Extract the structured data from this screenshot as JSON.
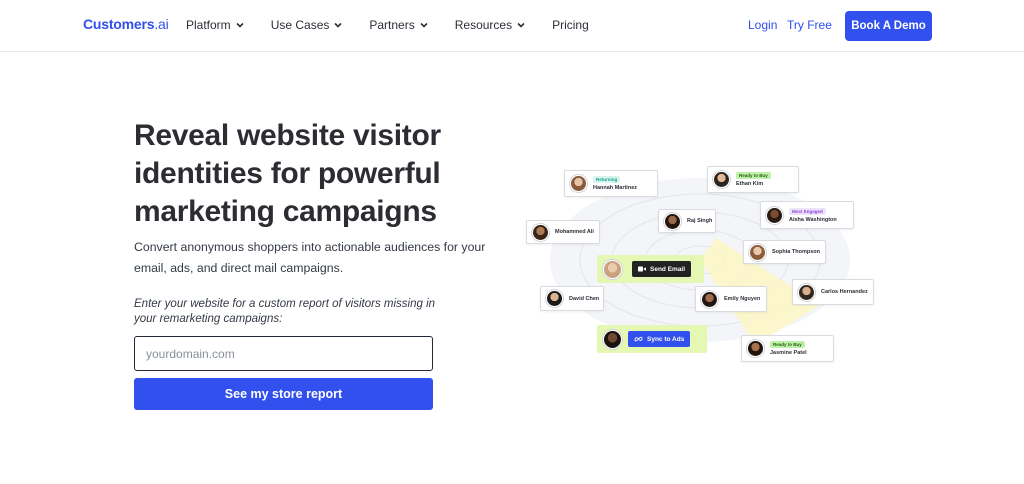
{
  "nav": {
    "logo_main": "Customers",
    "logo_suffix": ".ai",
    "menu": [
      {
        "label": "Platform",
        "has_dropdown": true
      },
      {
        "label": "Use Cases",
        "has_dropdown": true
      },
      {
        "label": "Partners",
        "has_dropdown": true
      },
      {
        "label": "Resources",
        "has_dropdown": true
      },
      {
        "label": "Pricing",
        "has_dropdown": false
      }
    ],
    "login": "Login",
    "try_free": "Try Free",
    "book_demo": "Book A Demo"
  },
  "hero": {
    "title": "Reveal website visitor identities for powerful marketing campaigns",
    "subtitle": "Convert anonymous shoppers into actionable audiences for your email, ads, and direct mail campaigns.",
    "prompt": "Enter your website for a custom report of visitors missing in your remarketing campaigns:",
    "input_placeholder": "yourdomain.com",
    "cta": "See my store report"
  },
  "graphic": {
    "cards": [
      {
        "name": "Hannah Martinez",
        "tag": "Returning",
        "tag_color": "teal"
      },
      {
        "name": "Ethan Kim",
        "tag": "Ready to Buy",
        "tag_color": "green"
      },
      {
        "name": "Aisha Washington",
        "tag": "Most Engaged",
        "tag_color": "purple"
      },
      {
        "name": "Mohammed Ali"
      },
      {
        "name": "Raj Singh"
      },
      {
        "name": "Sophia Thompson"
      },
      {
        "name": "David Chen"
      },
      {
        "name": "Emily Nguyen"
      },
      {
        "name": "Carlos Hernandez"
      },
      {
        "name": "Jasmine Patel",
        "tag": "Ready to Buy",
        "tag_color": "green"
      }
    ],
    "send_email": "Send Email",
    "sync_to_ads": "Sync to Ads"
  },
  "colors": {
    "brand": "#3150ee",
    "action_bg": "#e4f7b3",
    "text_dark": "#2b2d33"
  }
}
